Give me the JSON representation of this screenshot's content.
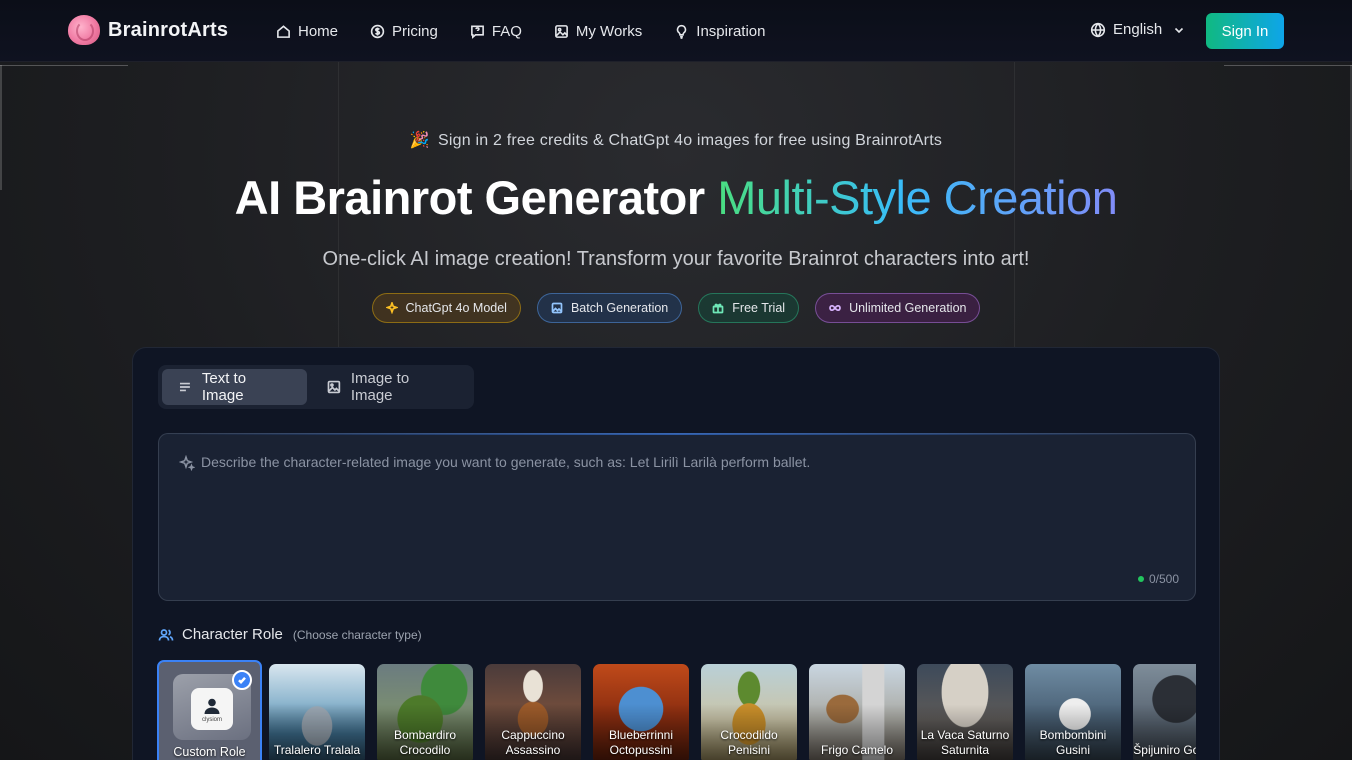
{
  "brand": {
    "name": "BrainrotArts"
  },
  "nav": {
    "links": [
      {
        "label": "Home",
        "icon": "home-icon"
      },
      {
        "label": "Pricing",
        "icon": "dollar-circle-icon"
      },
      {
        "label": "FAQ",
        "icon": "message-question-icon"
      },
      {
        "label": "My Works",
        "icon": "image-icon"
      },
      {
        "label": "Inspiration",
        "icon": "lightbulb-icon"
      }
    ],
    "language": "English",
    "signin_label": "Sign In"
  },
  "hero": {
    "announcement": "Sign in 2 free credits & ChatGpt 4o images for free using BrainrotArts",
    "title_main": "AI Brainrot Generator",
    "title_accent": "Multi-Style Creation",
    "subtitle": "One-click AI image creation! Transform your favorite Brainrot characters into art!",
    "badges": [
      {
        "label": "ChatGpt 4o Model",
        "color": "#fbbf24"
      },
      {
        "label": "Batch Generation",
        "color": "#93c5fd"
      },
      {
        "label": "Free Trial",
        "color": "#6ee7b7"
      },
      {
        "label": "Unlimited Generation",
        "color": "#d8b4fe"
      }
    ]
  },
  "generator": {
    "tabs": [
      {
        "label": "Text to Image",
        "active": true
      },
      {
        "label": "Image to Image",
        "active": false
      }
    ],
    "prompt": {
      "value": "",
      "placeholder": "Describe the character-related image you want to generate, such as: Let Lirilì Larilà perform ballet.",
      "counter": "0/500"
    },
    "character_section": {
      "title": "Character Role",
      "hint": "(Choose character type)"
    },
    "roles": [
      {
        "name": "Custom Role",
        "selected": true,
        "tile_label": "clysiom"
      },
      {
        "name": "Tralalero Tralala",
        "selected": false
      },
      {
        "name": "Bombardiro Crocodilo",
        "selected": false
      },
      {
        "name": "Cappuccino Assassino",
        "selected": false
      },
      {
        "name": "Blueberrinni Octopussini",
        "selected": false
      },
      {
        "name": "Crocodildo Penisini",
        "selected": false
      },
      {
        "name": "Frigo Camelo",
        "selected": false
      },
      {
        "name": "La Vaca Saturno Saturnita",
        "selected": false
      },
      {
        "name": "Bombombini Gusini",
        "selected": false
      },
      {
        "name": "Špijuniro Golubiro",
        "selected": false
      }
    ]
  }
}
